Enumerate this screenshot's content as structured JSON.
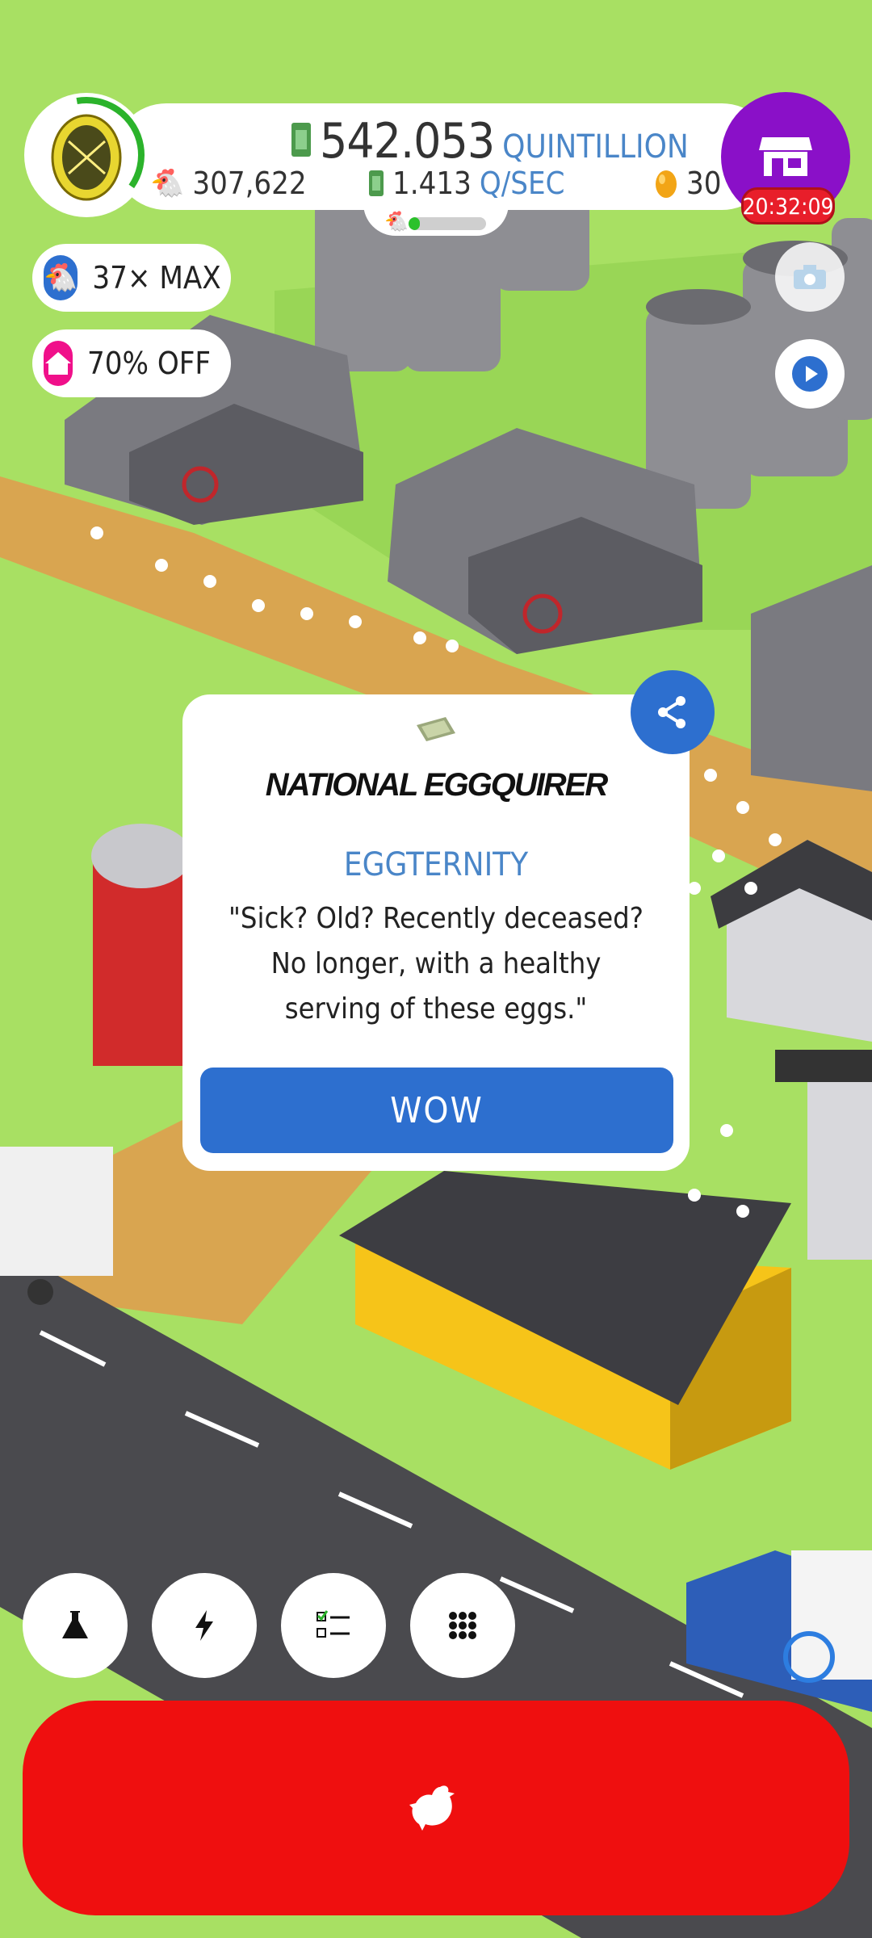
{
  "hud": {
    "cash_amount": "542.053",
    "cash_unit": "QUINTILLION",
    "chicken_count": "307,622",
    "income_rate": "1.413",
    "income_unit": "Q/SEC",
    "golden_eggs": "30",
    "shop_timer": "20:32:09",
    "habitat_fill_fraction": 0.15
  },
  "boosts": {
    "hatch_multiplier_label": "37× MAX",
    "discount_label": "70% OFF"
  },
  "news": {
    "masthead": "NATIONAL EGGQUIRER",
    "headline": "EGGTERNITY",
    "body": "\"Sick? Old? Recently deceased? No longer, with a healthy serving of these eggs.\"",
    "button_label": "WOW"
  },
  "toolbar": {
    "items": [
      {
        "icon": "flask-icon"
      },
      {
        "icon": "lightning-icon"
      },
      {
        "icon": "checklist-icon"
      },
      {
        "icon": "grid-menu-icon"
      }
    ]
  },
  "icons": {
    "camera": "camera-icon",
    "video": "play-video-icon",
    "share": "share-icon",
    "hatch": "chicken-icon",
    "shop": "shop-icon"
  },
  "colors": {
    "grass": "#a8e063",
    "accent_blue": "#2d6fcf",
    "shop_purple": "#8a10c8",
    "hatch_red": "#ef0f0f",
    "discount_pink": "#f0108a"
  }
}
